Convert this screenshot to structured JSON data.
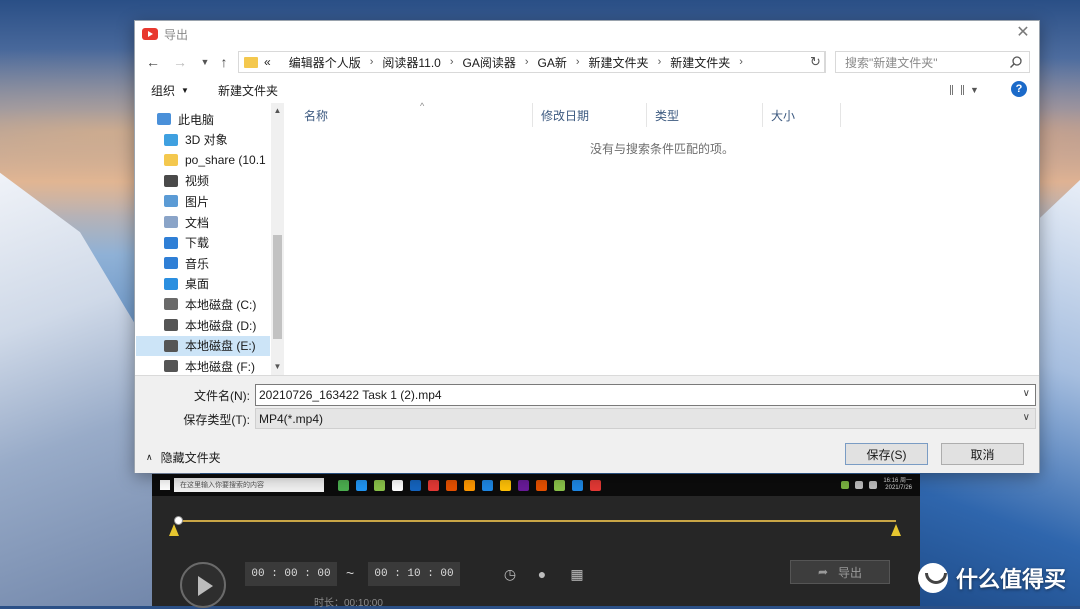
{
  "dialog": {
    "title": "导出",
    "address": {
      "overflow_marker": "«",
      "crumbs": [
        "编辑器个人版",
        "阅读器11.0",
        "GA阅读器",
        "GA新",
        "新建文件夹",
        "新建文件夹"
      ]
    },
    "search_placeholder": "搜索\"新建文件夹\"",
    "toolbar": {
      "organize_label": "组织",
      "new_folder_label": "新建文件夹"
    },
    "nav_items": [
      {
        "label": "此电脑",
        "icon": "computer-icon",
        "color": "#4a90d9"
      },
      {
        "label": "3D 对象",
        "icon": "cube-icon",
        "color": "#3fa0e0"
      },
      {
        "label": "po_share (10.1",
        "icon": "folder-icon",
        "color": "#f4c84e"
      },
      {
        "label": "视频",
        "icon": "video-icon",
        "color": "#4a4a4a"
      },
      {
        "label": "图片",
        "icon": "picture-icon",
        "color": "#5b9bd5"
      },
      {
        "label": "文档",
        "icon": "document-icon",
        "color": "#8aa4c8"
      },
      {
        "label": "下载",
        "icon": "download-icon",
        "color": "#2f7fd6"
      },
      {
        "label": "音乐",
        "icon": "music-icon",
        "color": "#2f7fd6"
      },
      {
        "label": "桌面",
        "icon": "desktop-icon",
        "color": "#2b8fe0"
      },
      {
        "label": "本地磁盘 (C:)",
        "icon": "system-drive-icon",
        "color": "#6a6a6a"
      },
      {
        "label": "本地磁盘 (D:)",
        "icon": "drive-icon",
        "color": "#555555"
      },
      {
        "label": "本地磁盘 (E:)",
        "icon": "drive-icon",
        "color": "#555555",
        "selected": true
      },
      {
        "label": "本地磁盘 (F:)",
        "icon": "drive-icon",
        "color": "#555555"
      }
    ],
    "columns": [
      {
        "label": "名称"
      },
      {
        "label": "修改日期"
      },
      {
        "label": "类型"
      },
      {
        "label": "大小"
      }
    ],
    "empty_message": "没有与搜索条件匹配的项。",
    "filename_label": "文件名(N):",
    "filename_value": "20210726_163422 Task 1 (2).mp4",
    "filetype_label": "保存类型(T):",
    "filetype_value": "MP4(*.mp4)",
    "hide_folders_label": "隐藏文件夹",
    "save_label": "保存(S)",
    "cancel_label": "取消"
  },
  "recorder": {
    "start_time": "00 : 00 : 00",
    "tilde": "~",
    "end_time": "00 : 10 : 00",
    "duration": "时长：00:10:00",
    "export_label": "导出",
    "taskbar_search": "在这里输入你要搜索的内容",
    "taskbar_icon_colors": [
      "#4caf50",
      "#2196f3",
      "#8bc34a",
      "#ffffff",
      "#1565c0",
      "#e53935",
      "#e65100",
      "#ff9800",
      "#1e88e5",
      "#ffc107",
      "#6a1b9a",
      "#e65100",
      "#8bc34a",
      "#1e88e5",
      "#e53935"
    ],
    "clock": [
      "16:16 周一",
      "2021/7/26"
    ]
  },
  "watermark": {
    "text": "什么值得买"
  },
  "colors": {
    "accent": "#1b6ac9",
    "selection": "#cce4f7",
    "timeline": "#c9a646",
    "marker": "#e6c630"
  }
}
